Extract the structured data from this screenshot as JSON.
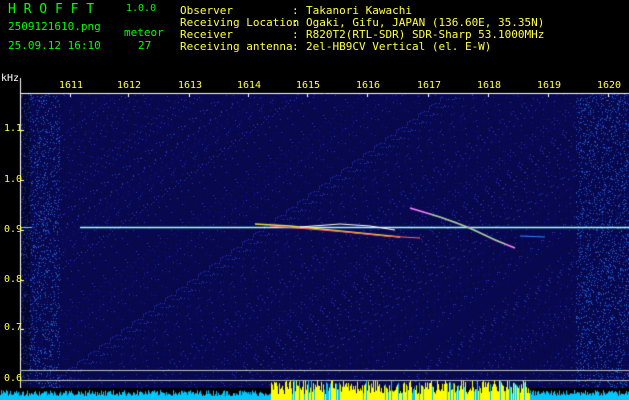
{
  "header": {
    "app_name": "H R O F F T",
    "version": "1.0.0",
    "filename": "2509121610.png",
    "datetime": "25.09.12 16:10",
    "detection_label": "meteor",
    "detection_count": "27"
  },
  "info": {
    "rows": [
      {
        "label": "Observer",
        "value": "Takanori Kawachi"
      },
      {
        "label": "Receiving Location",
        "value": "Ogaki, Gifu, JAPAN (136.60E, 35.35N)"
      },
      {
        "label": "Receiver",
        "value": "R820T2(RTL-SDR) SDR-Sharp 53.1000MHz"
      },
      {
        "label": "Receiving antenna",
        "value": "2el-HB9CV Vertical (el. E-W)"
      }
    ]
  },
  "axes": {
    "y_unit": "kHz",
    "y_ticks": [
      "1.1",
      "1.0",
      "0.9",
      "0.8",
      "0.7",
      "0.6"
    ],
    "x_ticks": [
      "1611",
      "1612",
      "1613",
      "1614",
      "1615",
      "1616",
      "1617",
      "1618",
      "1619",
      "1620"
    ]
  },
  "colors": {
    "background": "#000000",
    "plot_background": "#0a0a4a",
    "text_green": "#00ff00",
    "text_yellow": "#ffff44",
    "carrier_line": "#aaffff",
    "level_fill": "#00c8ff",
    "level_peak": "#ffff00"
  }
}
